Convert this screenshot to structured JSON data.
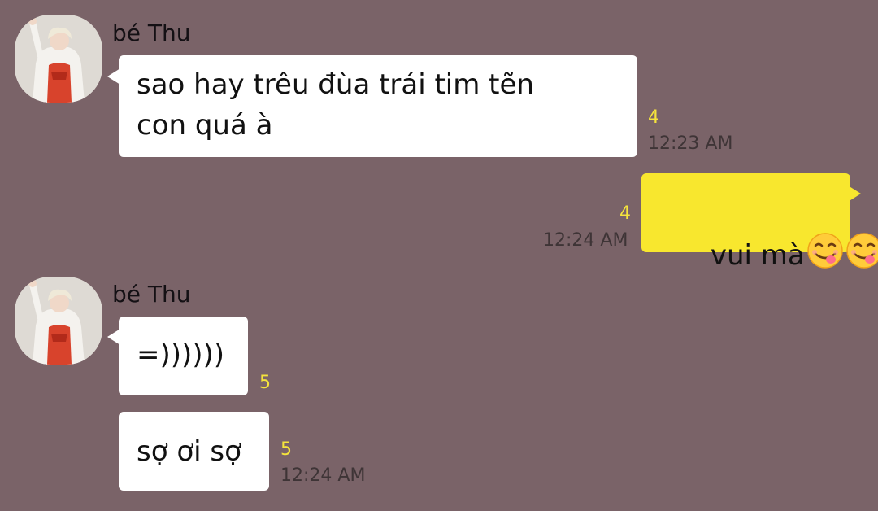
{
  "colors": {
    "background": "#7a6368",
    "incoming_bubble": "#ffffff",
    "outgoing_bubble": "#f8e72e",
    "unread_count": "#f5e43c",
    "timestamp": "#3e3436"
  },
  "messages": [
    {
      "sender": "bé Thu",
      "direction": "incoming",
      "line1": "sao hay trêu đùa trái tim tẽn",
      "line2": "con quá à",
      "unread": "4",
      "time": "12:23 AM"
    },
    {
      "direction": "outgoing",
      "text": "vui mà",
      "emoji": [
        "yum-face-icon",
        "yum-face-icon"
      ],
      "unread": "4",
      "time": "12:24 AM"
    },
    {
      "sender": "bé Thu",
      "direction": "incoming",
      "text": "=))))))",
      "unread": "5"
    },
    {
      "direction": "incoming",
      "text": "sợ ơi sợ",
      "unread": "5",
      "time": "12:24 AM"
    }
  ]
}
